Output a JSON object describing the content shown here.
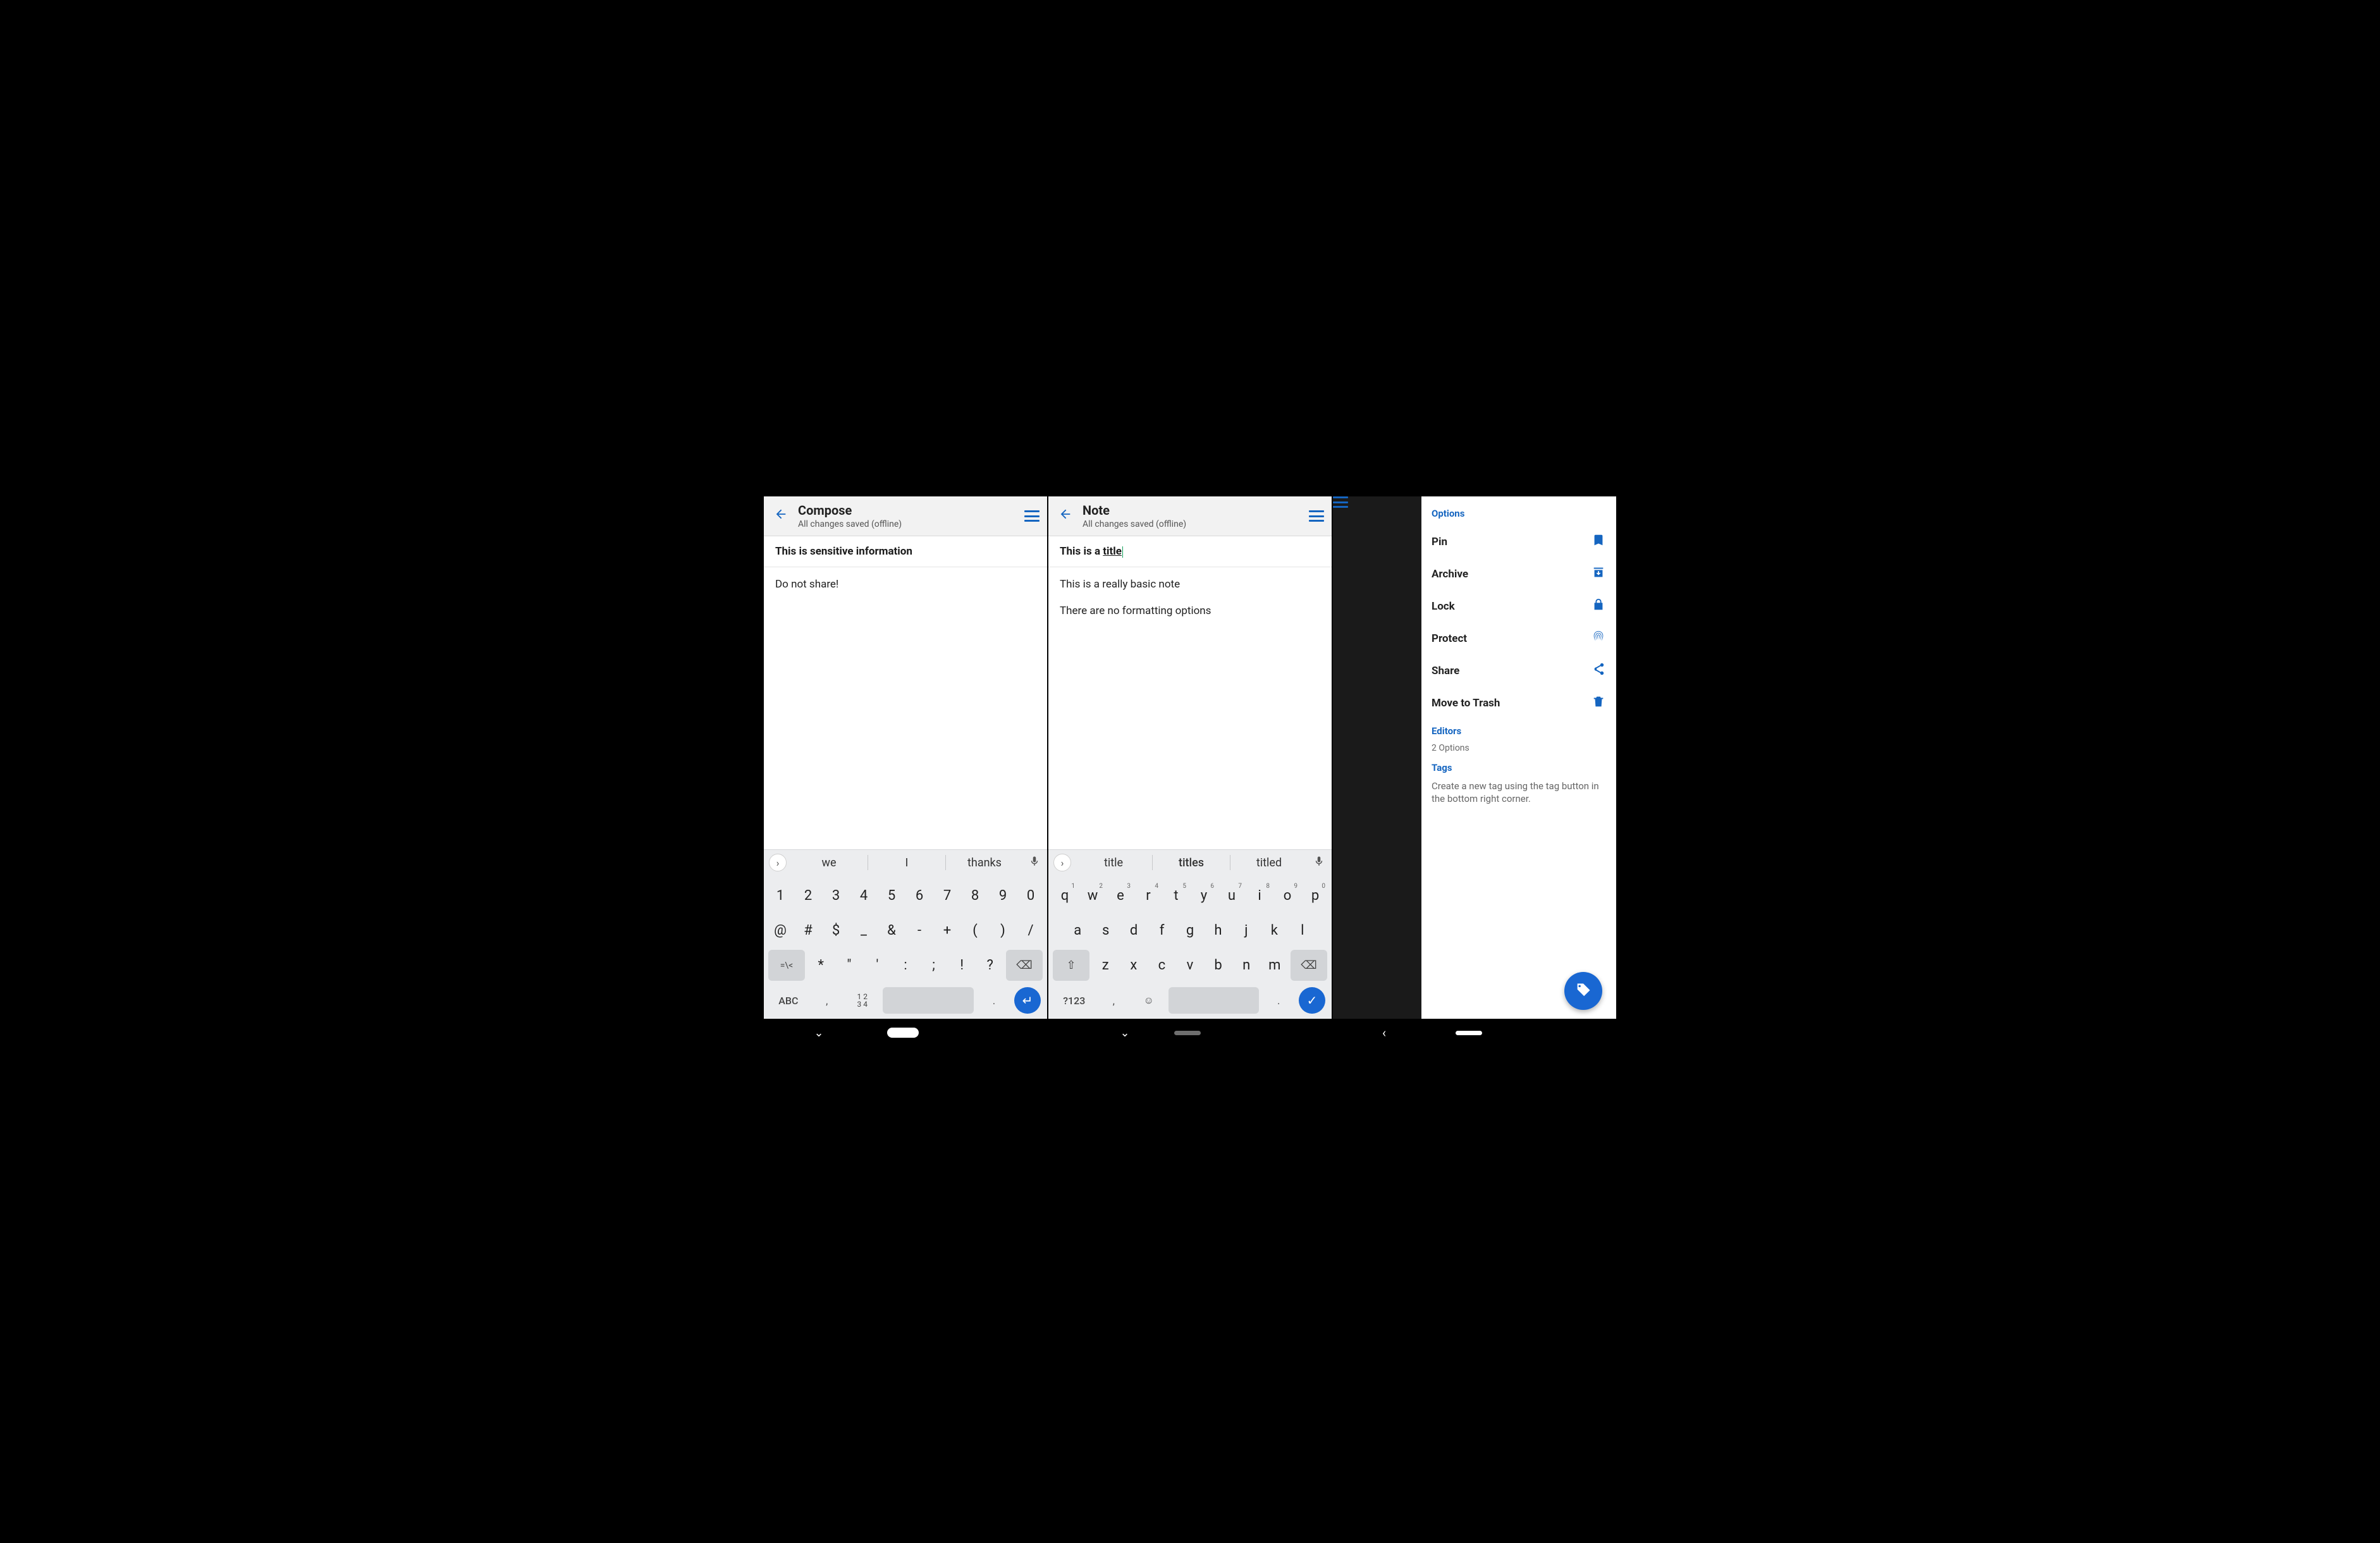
{
  "screen1": {
    "appbar": {
      "title": "Compose",
      "subtitle": "All changes saved (offline)"
    },
    "note_title": "This is sensitive information",
    "note_body_lines": [
      "Do not share!"
    ],
    "suggestions": [
      "we",
      "I",
      "thanks"
    ],
    "kbd_rows": {
      "row1": [
        "1",
        "2",
        "3",
        "4",
        "5",
        "6",
        "7",
        "8",
        "9",
        "0"
      ],
      "row2": [
        "@",
        "#",
        "$",
        "_",
        "&",
        "-",
        "+",
        "(",
        ")",
        "/"
      ],
      "row3_left": "=\\<",
      "row3_mid": [
        "*",
        "\"",
        "'",
        ":",
        ";",
        "!",
        "?"
      ],
      "row3_del": "⌫",
      "row4_abc": "ABC",
      "row4_comma": ",",
      "row4_12_34_top": "1 2",
      "row4_12_34_bottom": "3 4",
      "row4_dot": ".",
      "row4_enter": "↵"
    }
  },
  "screen2": {
    "appbar": {
      "title": "Note",
      "subtitle": "All changes saved (offline)"
    },
    "note_title_prefix": "This is a ",
    "note_title_underlined": "title",
    "note_body_lines": [
      "This is a really basic note",
      "There are no formatting options"
    ],
    "suggestions": [
      "title",
      "titles",
      "titled"
    ],
    "kbd_rows": {
      "row1": [
        "q",
        "w",
        "e",
        "r",
        "t",
        "y",
        "u",
        "i",
        "o",
        "p"
      ],
      "row1_sup": [
        "1",
        "2",
        "3",
        "4",
        "5",
        "6",
        "7",
        "8",
        "9",
        "0"
      ],
      "row2": [
        "a",
        "s",
        "d",
        "f",
        "g",
        "h",
        "j",
        "k",
        "l"
      ],
      "row3_shift": "⇧",
      "row3_mid": [
        "z",
        "x",
        "c",
        "v",
        "b",
        "n",
        "m"
      ],
      "row3_del": "⌫",
      "row4_123": "?123",
      "row4_comma": ",",
      "row4_emoji": "☺",
      "row4_dot": ".",
      "row4_done": "✓"
    }
  },
  "screen3": {
    "sections": {
      "options_label": "Options",
      "editors_label": "Editors",
      "editors_sub": "2 Options",
      "tags_label": "Tags",
      "tags_hint": "Create a new tag using the tag button in the bottom right corner."
    },
    "options": [
      {
        "label": "Pin",
        "icon": "bookmark-icon"
      },
      {
        "label": "Archive",
        "icon": "archive-icon"
      },
      {
        "label": "Lock",
        "icon": "lock-icon"
      },
      {
        "label": "Protect",
        "icon": "fingerprint-icon"
      },
      {
        "label": "Share",
        "icon": "share-icon"
      },
      {
        "label": "Move to Trash",
        "icon": "trash-icon"
      }
    ]
  }
}
